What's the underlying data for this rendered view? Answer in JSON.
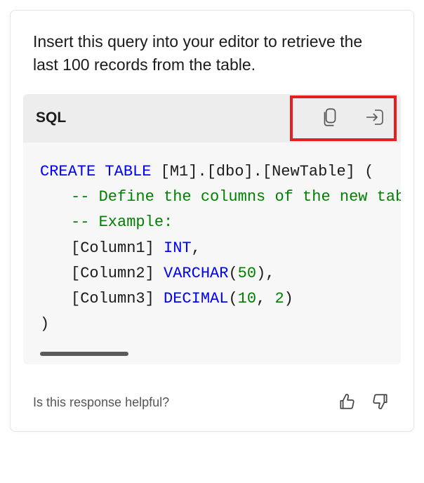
{
  "intro": "Insert this query into your editor to retrieve the last 100 records from the table.",
  "codeBlock": {
    "language": "SQL",
    "lines": {
      "l1a": "CREATE TABLE",
      "l1b": " [M1].[dbo].[NewTable] (",
      "l2": "-- Define the columns of the new tabl",
      "l3": "-- Example:",
      "l4a": "[Column1] ",
      "l4b": "INT",
      "l4c": ",",
      "l5a": "[Column2] ",
      "l5b": "VARCHAR",
      "l5c": "(",
      "l5d": "50",
      "l5e": "),",
      "l6a": "[Column3] ",
      "l6b": "DECIMAL",
      "l6c": "(",
      "l6d": "10",
      "l6e": ", ",
      "l6f": "2",
      "l6g": ")",
      "l7": ")"
    }
  },
  "feedback": {
    "prompt": "Is this response helpful?"
  }
}
